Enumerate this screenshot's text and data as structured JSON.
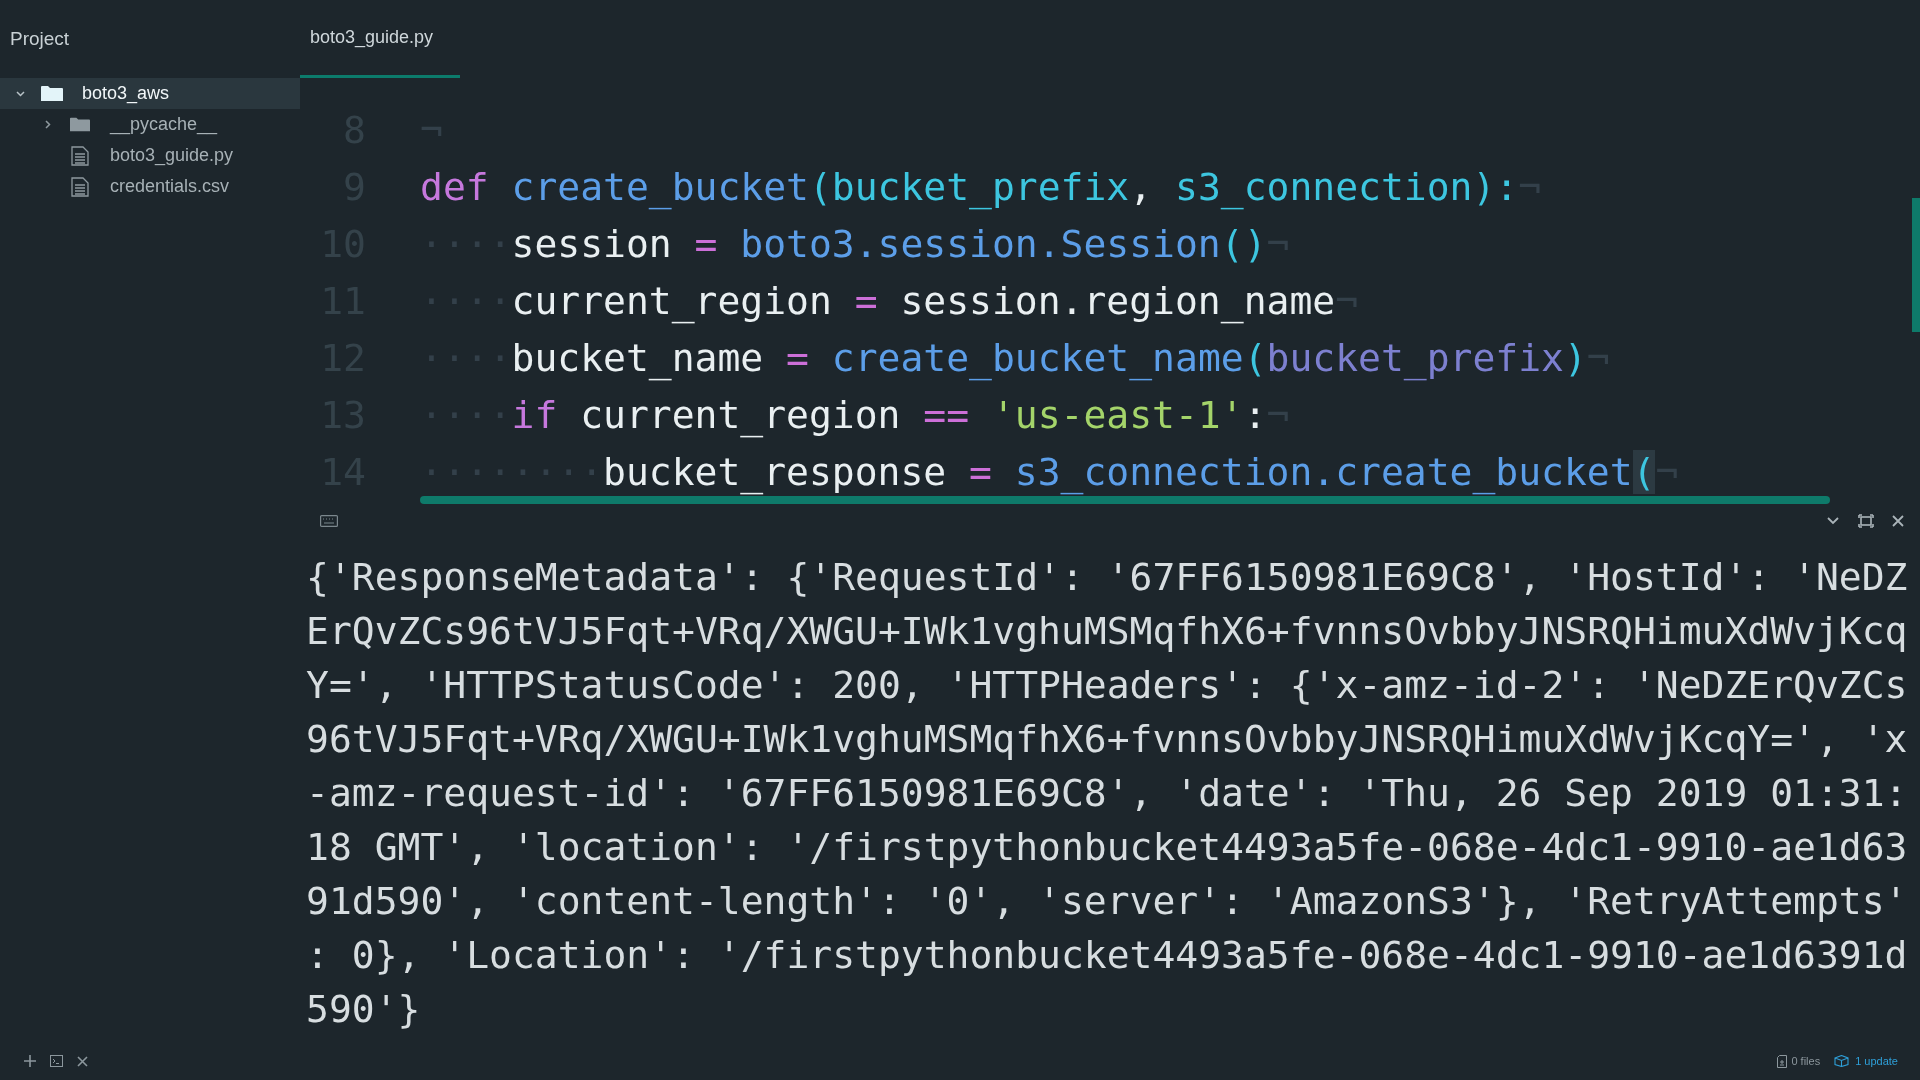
{
  "sidebar": {
    "title": "Project",
    "tree": [
      {
        "label": "boto3_aws",
        "kind": "folder",
        "expanded": true,
        "selected": true,
        "children": [
          {
            "label": "__pycache__",
            "kind": "folder",
            "expanded": false,
            "selected": false
          },
          {
            "label": "boto3_guide.py",
            "kind": "file",
            "selected": false
          },
          {
            "label": "credentials.csv",
            "kind": "file",
            "selected": false
          }
        ]
      }
    ]
  },
  "tabs": [
    {
      "label": "boto3_guide.py",
      "selected": true
    }
  ],
  "editor": {
    "lines": [
      {
        "number": "8",
        "tokens": [
          {
            "text": "¬",
            "kind": "eol"
          }
        ]
      },
      {
        "number": "9",
        "tokens": [
          {
            "text": "def",
            "kind": "keyword"
          },
          {
            "text": " create_bucket",
            "kind": "func"
          },
          {
            "text": "(",
            "kind": "punct"
          },
          {
            "text": "bucket_prefix",
            "kind": "param"
          },
          {
            "text": ", ",
            "kind": "plain"
          },
          {
            "text": "s3_connection",
            "kind": "param"
          },
          {
            "text": "):",
            "kind": "punct"
          },
          {
            "text": "¬",
            "kind": "eol"
          }
        ]
      },
      {
        "number": "10",
        "tokens": [
          {
            "text": "····",
            "kind": "ws"
          },
          {
            "text": "session ",
            "kind": "plain"
          },
          {
            "text": "=",
            "kind": "op"
          },
          {
            "text": " boto3.session.Session",
            "kind": "func"
          },
          {
            "text": "()",
            "kind": "punct"
          },
          {
            "text": "¬",
            "kind": "eol"
          }
        ]
      },
      {
        "number": "11",
        "tokens": [
          {
            "text": "····",
            "kind": "ws"
          },
          {
            "text": "current_region ",
            "kind": "plain"
          },
          {
            "text": "=",
            "kind": "op"
          },
          {
            "text": " session.region_name",
            "kind": "plain"
          },
          {
            "text": "¬",
            "kind": "eol"
          }
        ]
      },
      {
        "number": "12",
        "tokens": [
          {
            "text": "····",
            "kind": "ws"
          },
          {
            "text": "bucket_name ",
            "kind": "plain"
          },
          {
            "text": "=",
            "kind": "op"
          },
          {
            "text": " create_bucket_name",
            "kind": "func"
          },
          {
            "text": "(",
            "kind": "punct"
          },
          {
            "text": "bucket_prefix",
            "kind": "arg"
          },
          {
            "text": ")",
            "kind": "punct"
          },
          {
            "text": "¬",
            "kind": "eol"
          }
        ]
      },
      {
        "number": "13",
        "tokens": [
          {
            "text": "····",
            "kind": "ws"
          },
          {
            "text": "if",
            "kind": "keyword"
          },
          {
            "text": " current_region ",
            "kind": "plain"
          },
          {
            "text": "==",
            "kind": "op"
          },
          {
            "text": " 'us-east-1'",
            "kind": "string"
          },
          {
            "text": ":",
            "kind": "plain"
          },
          {
            "text": "¬",
            "kind": "eol"
          }
        ]
      },
      {
        "number": "14",
        "tokens": [
          {
            "text": "········",
            "kind": "ws"
          },
          {
            "text": "bucket_response ",
            "kind": "plain"
          },
          {
            "text": "=",
            "kind": "op"
          },
          {
            "text": " s3_connection.create_bucket",
            "kind": "func"
          },
          {
            "text": "(",
            "kind": "match"
          },
          {
            "text": "¬",
            "kind": "eol"
          }
        ]
      }
    ]
  },
  "terminal": {
    "output": [
      "{'ResponseMetadata': {'RequestId': '67FF6150981E69C8', 'HostId': 'NeDZ",
      "ErQvZCs96tVJ5Fqt+VRq/XWGU+IWk1vghuMSMqfhX6+fvnnsOvbbyJNSRQHimuXdWvjKcq",
      "Y=', 'HTTPStatusCode': 200, 'HTTPHeaders': {'x-amz-id-2': 'NeDZErQvZCs",
      "96tVJ5Fqt+VRq/XWGU+IWk1vghuMSMqfhX6+fvnnsOvbbyJNSRQHimuXdWvjKcqY=', 'x",
      "-amz-request-id': '67FF6150981E69C8', 'date': 'Thu, 26 Sep 2019 01:31:",
      "18 GMT', 'location': '/firstpythonbucket4493a5fe-068e-4dc1-9910-ae1d63",
      "91d590', 'content-length': '0', 'server': 'AmazonS3'}, 'RetryAttempts'",
      ": 0}, 'Location': '/firstpythonbucket4493a5fe-068e-4dc1-9910-ae1d6391d",
      "590'}"
    ]
  },
  "status_bar": {
    "files": "0 files",
    "updates": "1 update"
  }
}
